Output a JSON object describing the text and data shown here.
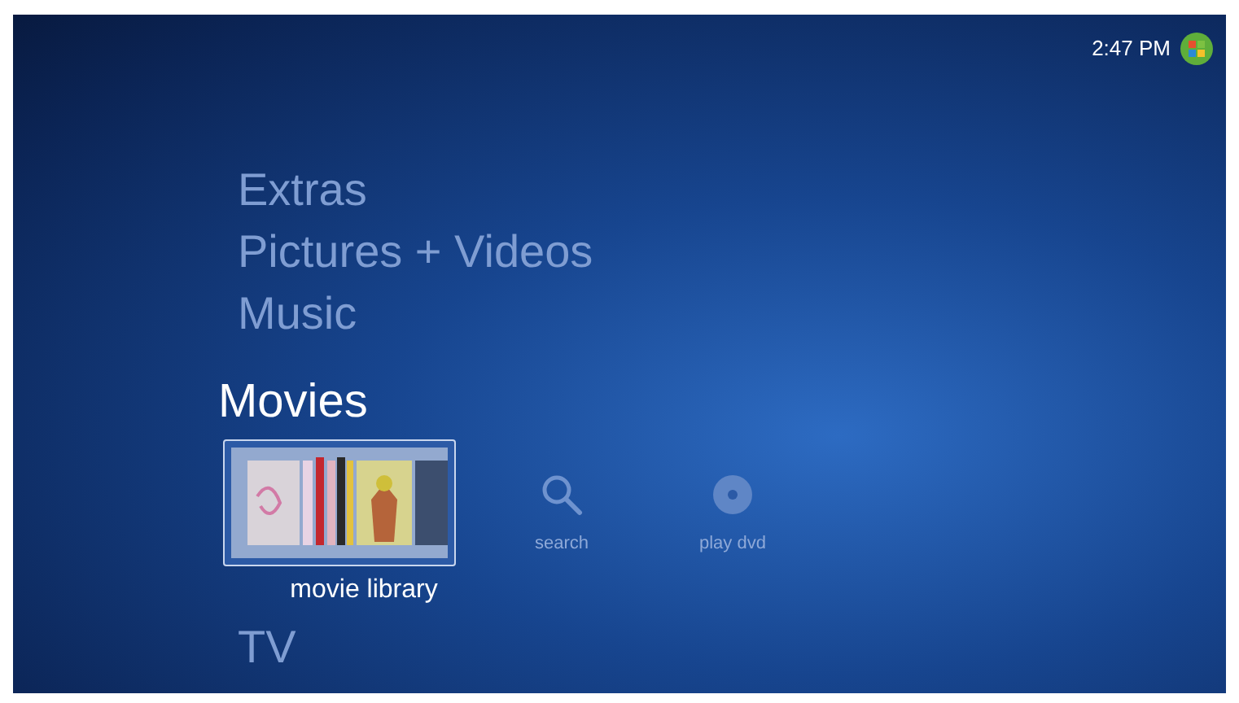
{
  "top_bar": {
    "time": "2:47 PM"
  },
  "categories": [
    {
      "label": "Extras",
      "selected": false
    },
    {
      "label": "Pictures + Videos",
      "selected": false
    },
    {
      "label": "Music",
      "selected": false
    },
    {
      "label": "Movies",
      "selected": true,
      "tiles": [
        {
          "kind": "library",
          "label": "movie library",
          "selected": true
        },
        {
          "kind": "search",
          "label": "search",
          "selected": false
        },
        {
          "kind": "dvd",
          "label": "play dvd",
          "selected": false
        }
      ]
    },
    {
      "label": "TV",
      "selected": false
    }
  ]
}
